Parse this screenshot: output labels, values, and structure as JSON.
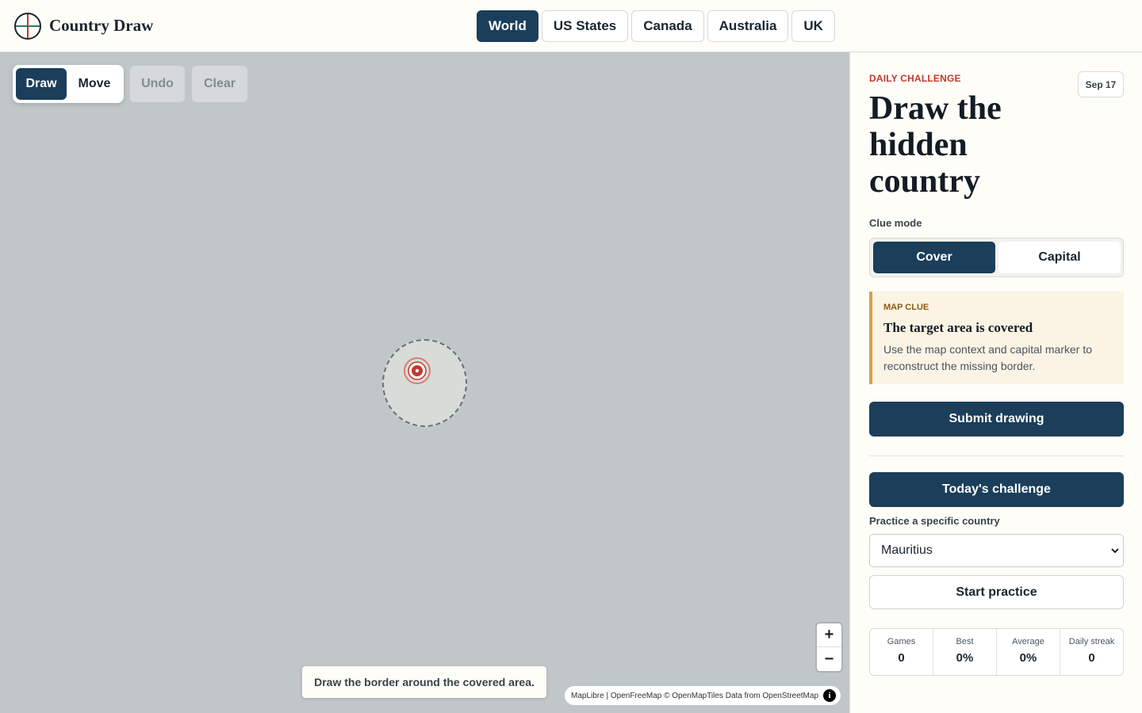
{
  "app": {
    "name": "Country Draw",
    "logo_icon": "crosshair-globe-icon"
  },
  "nav": {
    "tabs": [
      {
        "label": "World",
        "active": true
      },
      {
        "label": "US States",
        "active": false
      },
      {
        "label": "Canada",
        "active": false
      },
      {
        "label": "Australia",
        "active": false
      },
      {
        "label": "UK",
        "active": false
      }
    ]
  },
  "map": {
    "tools": {
      "draw": "Draw",
      "move": "Move",
      "active": "draw"
    },
    "undo": "Undo",
    "clear": "Clear",
    "hint": "Draw the border around the covered area.",
    "zoom": {
      "in": "+",
      "out": "−"
    },
    "attribution": {
      "maplibre": "MapLibre",
      "sep": " | ",
      "openfreemap": "OpenFreeMap",
      "openmaptiles": "© OpenMapTiles",
      "data_from": " Data from ",
      "osm": "OpenStreetMap",
      "info": "i"
    }
  },
  "sidebar": {
    "eyebrow": "DAILY CHALLENGE",
    "date": "Sep 17",
    "title": "Draw the hidden country",
    "clue_mode_label": "Clue mode",
    "clue_modes": {
      "cover": "Cover",
      "capital": "Capital",
      "active": "cover"
    },
    "clue_card": {
      "eyebrow": "MAP CLUE",
      "title": "The target area is covered",
      "text": "Use the map context and capital marker to reconstruct the missing border."
    },
    "submit": "Submit drawing",
    "todays_challenge": "Today's challenge",
    "practice_label": "Practice a specific country",
    "practice_select": "Mauritius",
    "start_practice": "Start practice",
    "stats": [
      {
        "label": "Games",
        "value": "0"
      },
      {
        "label": "Best",
        "value": "0%"
      },
      {
        "label": "Average",
        "value": "0%"
      },
      {
        "label": "Daily streak",
        "value": "0"
      }
    ]
  },
  "colors": {
    "primary": "#1b3e5a",
    "accent": "#c0392b",
    "clue_border": "#d4a24a",
    "map_bg": "#c1c6c8"
  }
}
